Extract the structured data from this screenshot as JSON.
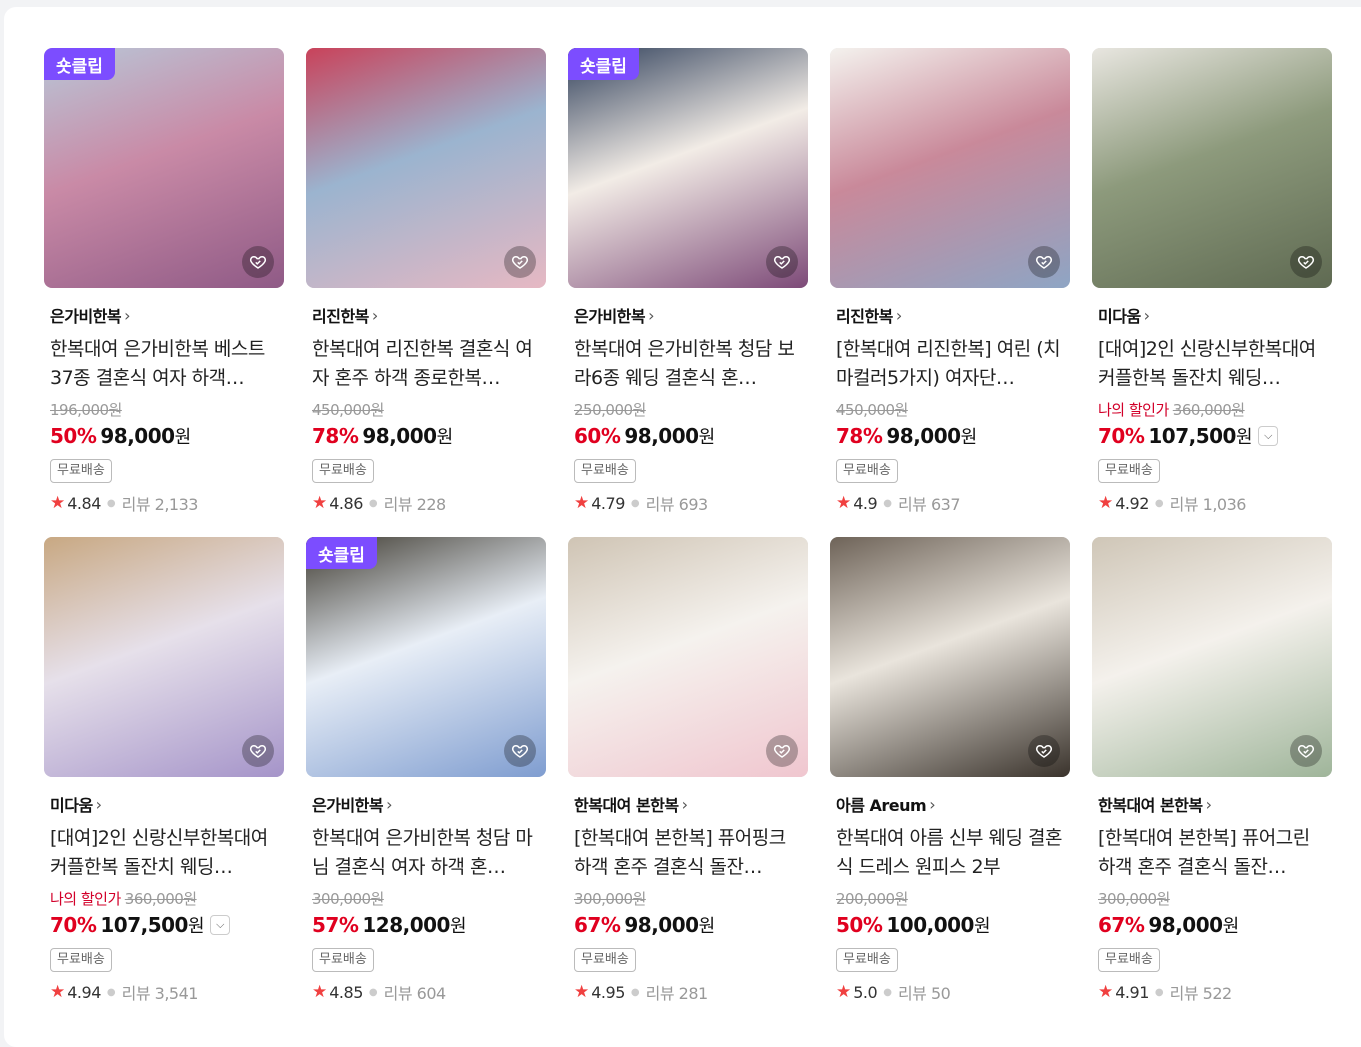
{
  "products": [
    {
      "badge": "숏클립",
      "store": "은가비한복",
      "title": "한복대여 은가비한복 베스트37종 결혼식 여자 하객…",
      "orig": "196,000원",
      "mine": "",
      "pct": "50%",
      "price": "98,000",
      "unit": "원",
      "dropdown": false,
      "tag": "무료배송",
      "score": "4.84",
      "review": "리뷰 2,133",
      "colors": [
        "#b8c7d8",
        "#c98aa6",
        "#8f5a86"
      ]
    },
    {
      "badge": "",
      "store": "리진한복",
      "title": "한복대여 리진한복 결혼식 여자 혼주 하객 종로한복…",
      "orig": "450,000원",
      "mine": "",
      "pct": "78%",
      "price": "98,000",
      "unit": "원",
      "dropdown": false,
      "tag": "무료배송",
      "score": "4.86",
      "review": "리뷰 228",
      "colors": [
        "#c9425a",
        "#9bb4cf",
        "#e6b8c3"
      ]
    },
    {
      "badge": "숏클립",
      "store": "은가비한복",
      "title": "한복대여 은가비한복 청담 보라6종 웨딩 결혼식 혼…",
      "orig": "250,000원",
      "mine": "",
      "pct": "60%",
      "price": "98,000",
      "unit": "원",
      "dropdown": false,
      "tag": "무료배송",
      "score": "4.79",
      "review": "리뷰 693",
      "colors": [
        "#2f3f5a",
        "#f2ece6",
        "#7d4a78"
      ]
    },
    {
      "badge": "",
      "store": "리진한복",
      "title": "[한복대여 리진한복] 여린 (치마컬러5가지) 여자단…",
      "orig": "450,000원",
      "mine": "",
      "pct": "78%",
      "price": "98,000",
      "unit": "원",
      "dropdown": false,
      "tag": "무료배송",
      "score": "4.9",
      "review": "리뷰 637",
      "colors": [
        "#f4f2ee",
        "#c9899a",
        "#8ea5c4"
      ]
    },
    {
      "badge": "",
      "store": "미다움",
      "title": "[대여]2인 신랑신부한복대여 커플한복 돌잔치 웨딩…",
      "orig": "360,000원",
      "mine": "나의 할인가",
      "pct": "70%",
      "price": "107,500",
      "unit": "원",
      "dropdown": true,
      "tag": "무료배송",
      "score": "4.92",
      "review": "리뷰 1,036",
      "colors": [
        "#e8e6e0",
        "#8d9a7c",
        "#5f6a52"
      ]
    },
    {
      "badge": "",
      "store": "미다움",
      "title": "[대여]2인 신랑신부한복대여 커플한복 돌잔치 웨딩…",
      "orig": "360,000원",
      "mine": "나의 할인가",
      "pct": "70%",
      "price": "107,500",
      "unit": "원",
      "dropdown": true,
      "tag": "무료배송",
      "score": "4.94",
      "review": "리뷰 3,541",
      "colors": [
        "#c8a882",
        "#e6e0ea",
        "#a594c9"
      ]
    },
    {
      "badge": "숏클립",
      "store": "은가비한복",
      "title": "한복대여 은가비한복 청담 마님 결혼식 여자 하객 혼…",
      "orig": "300,000원",
      "mine": "",
      "pct": "57%",
      "price": "128,000",
      "unit": "원",
      "dropdown": false,
      "tag": "무료배송",
      "score": "4.85",
      "review": "리뷰 604",
      "colors": [
        "#3e3a30",
        "#e8eef6",
        "#7f9dd0"
      ]
    },
    {
      "badge": "",
      "store": "한복대여 본한복",
      "title": "[한복대여 본한복] 퓨어핑크 하객 혼주 결혼식 돌잔…",
      "orig": "300,000원",
      "mine": "",
      "pct": "67%",
      "price": "98,000",
      "unit": "원",
      "dropdown": false,
      "tag": "무료배송",
      "score": "4.95",
      "review": "리뷰 281",
      "colors": [
        "#cfc4b4",
        "#f5f2ee",
        "#f0c6cf"
      ]
    },
    {
      "badge": "",
      "store": "아름 Areum",
      "title": "한복대여 아름 신부 웨딩 결혼식 드레스 원피스 2부",
      "orig": "200,000원",
      "mine": "",
      "pct": "50%",
      "price": "100,000",
      "unit": "원",
      "dropdown": false,
      "tag": "무료배송",
      "score": "5.0",
      "review": "리뷰 50",
      "colors": [
        "#6e6358",
        "#e9e4dc",
        "#3a332c"
      ]
    },
    {
      "badge": "",
      "store": "한복대여 본한복",
      "title": "[한복대여 본한복] 퓨어그린 하객 혼주 결혼식 돌잔…",
      "orig": "300,000원",
      "mine": "",
      "pct": "67%",
      "price": "98,000",
      "unit": "원",
      "dropdown": false,
      "tag": "무료배송",
      "score": "4.91",
      "review": "리뷰 522",
      "colors": [
        "#cfc6b7",
        "#f4f1ec",
        "#9fb59a"
      ]
    }
  ]
}
